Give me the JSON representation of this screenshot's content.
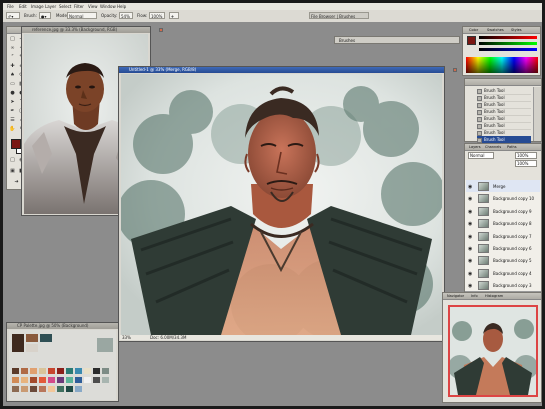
{
  "app": {
    "menus": [
      "File",
      "Edit",
      "Image",
      "Layer",
      "Select",
      "Filter",
      "View",
      "Window",
      "Help"
    ],
    "options": {
      "brush_label": "Brush:",
      "mode_label": "Mode:",
      "mode_value": "Normal",
      "opacity_label": "Opacity:",
      "opacity_value": "54%",
      "flow_label": "Flow:",
      "flow_value": "100%",
      "brushes_tab": "Brushes",
      "file_browser_tab": "File Browser | Brushes"
    }
  },
  "documents": {
    "reference": {
      "title": "reference.jpg @ 33.3% (Background, RGB)"
    },
    "main": {
      "title": "Untitled-1 @ 33% (Merge, RGB/8)",
      "zoom": "33%",
      "doc_size": "Doc: 6.00M/34.3M"
    },
    "palette": {
      "title": "CP Palette.jpg @ 50% (Background)"
    }
  },
  "panels": {
    "color": {
      "tabs": [
        "Color",
        "Swatches",
        "Styles"
      ]
    },
    "history": {
      "items": [
        {
          "label": "Brush Tool"
        },
        {
          "label": "Brush Tool"
        },
        {
          "label": "Brush Tool"
        },
        {
          "label": "Brush Tool"
        },
        {
          "label": "Brush Tool"
        },
        {
          "label": "Brush Tool"
        },
        {
          "label": "Brush Tool"
        },
        {
          "label": "Brush Tool"
        }
      ]
    },
    "layers": {
      "tabs": [
        "Layers",
        "Channels",
        "Paths"
      ],
      "blend_mode": "Normal",
      "opacity": "100%",
      "fill": "100%",
      "items": [
        {
          "label": "Merge"
        },
        {
          "label": "Background copy 10"
        },
        {
          "label": "Background copy 9"
        },
        {
          "label": "Background copy 8"
        },
        {
          "label": "Background copy 7"
        },
        {
          "label": "Background copy 6"
        },
        {
          "label": "Background copy 5"
        },
        {
          "label": "Background copy 4"
        },
        {
          "label": "Background copy 3"
        }
      ]
    },
    "navigator": {
      "tabs": [
        "Navigator",
        "Info",
        "Histogram"
      ]
    }
  },
  "colors": {
    "foreground": "#7a1612",
    "background": "#ffffff",
    "titlebar": "#264b93"
  }
}
